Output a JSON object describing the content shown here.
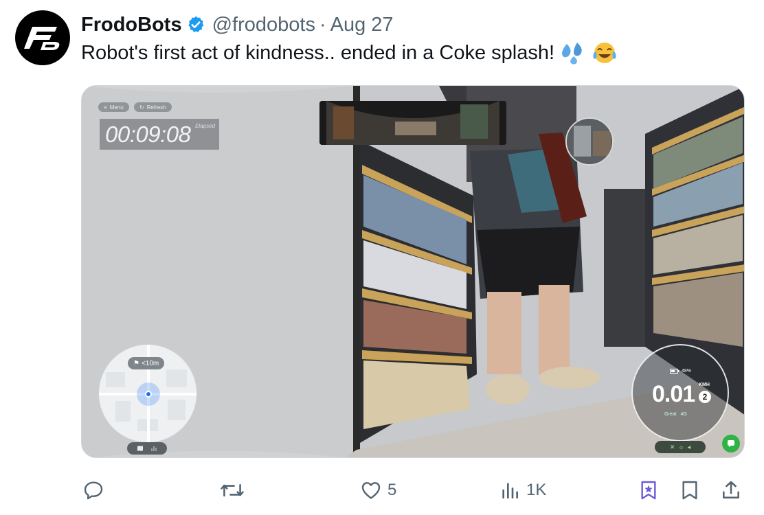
{
  "tweet": {
    "display_name": "FrodoBots",
    "handle": "@frodobots",
    "separator": "·",
    "date": "Aug 27",
    "text": "Robot's first act of kindness.. ended in a Coke splash!",
    "emojis": [
      "sweat-droplets-icon",
      "tears-of-joy-icon"
    ]
  },
  "video_hud": {
    "menu_label": "Menu",
    "refresh_label": "Refresh",
    "elapsed_time": "00:09:08",
    "elapsed_label": "Elapsed",
    "map_distance": "<10m",
    "battery": "48%",
    "speed": "0.01",
    "speed_unit": "KMH",
    "gear": "2",
    "signal_quality": "Great",
    "network": "4G"
  },
  "actions": {
    "replies": "",
    "reposts": "",
    "likes": "5",
    "views": "1K"
  },
  "colors": {
    "verified": "#1d9bf0",
    "muted_text": "#536471",
    "bookmark_accent": "#6b5bd6",
    "hud_green": "#2fb344"
  }
}
